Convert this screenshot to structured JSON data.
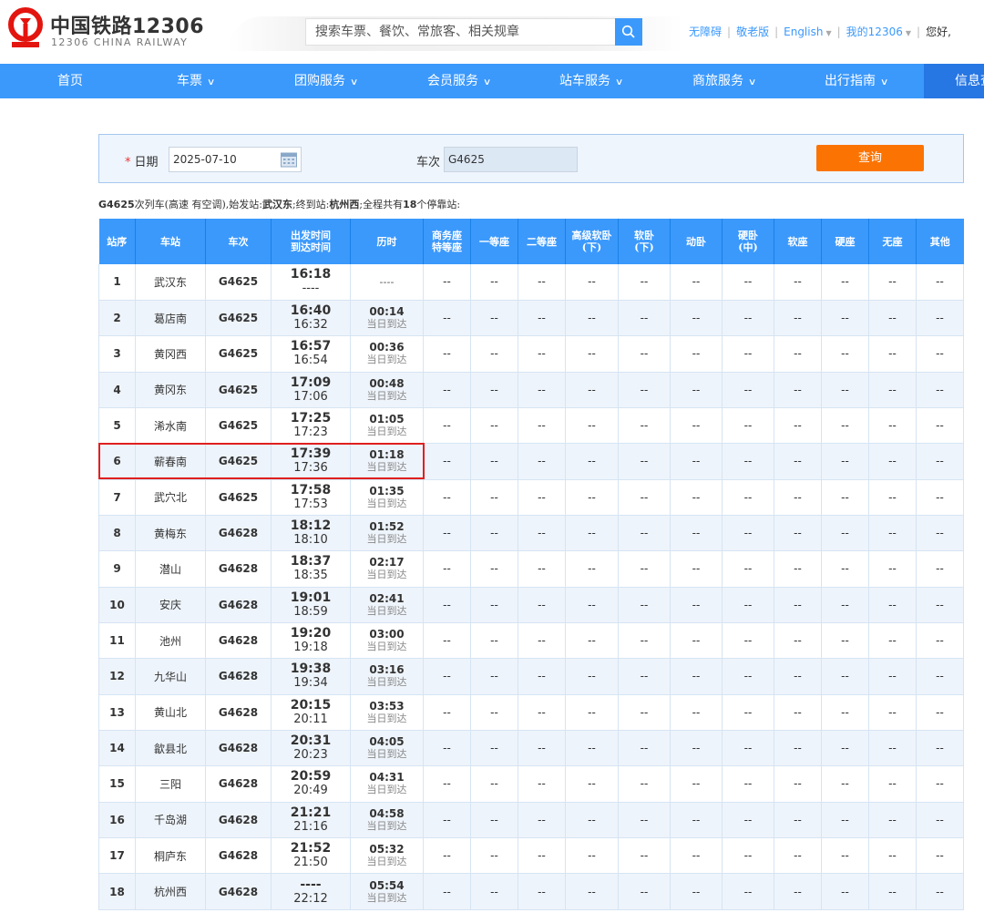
{
  "header": {
    "logo_cn": "中国铁路12306",
    "logo_en": "12306 CHINA RAILWAY",
    "search_placeholder": "搜索车票、餐饮、常旅客、相关规章",
    "links": [
      {
        "label": "无障碍",
        "caret": false
      },
      {
        "label": "敬老版",
        "caret": false
      },
      {
        "label": "English",
        "caret": true
      },
      {
        "label": "我的12306",
        "caret": true
      },
      {
        "label": "您好,",
        "caret": false
      }
    ],
    "brand_color": "#3b99fc"
  },
  "nav": {
    "items": [
      {
        "label": "首页",
        "chevron": false
      },
      {
        "label": "车票",
        "chevron": true
      },
      {
        "label": "团购服务",
        "chevron": true
      },
      {
        "label": "会员服务",
        "chevron": true
      },
      {
        "label": "站车服务",
        "chevron": true
      },
      {
        "label": "商旅服务",
        "chevron": true
      },
      {
        "label": "出行指南",
        "chevron": true
      },
      {
        "label": "信息查",
        "chevron": false
      }
    ]
  },
  "query": {
    "date_label": "日期",
    "required_mark": "*",
    "date_value": "2025-07-10",
    "train_label": "车次",
    "train_value": "G4625",
    "submit_label": "查询"
  },
  "summary": {
    "train": "G4625",
    "text1": "次列车(高速 有空调),始发站:",
    "origin": "武汉东",
    "text2": ";终到站:",
    "destination": "杭州西",
    "text3": ";全程共有",
    "stops": "18",
    "text4": "个停靠站:"
  },
  "table": {
    "headers": [
      [
        "站序"
      ],
      [
        "车站"
      ],
      [
        "车次"
      ],
      [
        "出发时间",
        "到达时间"
      ],
      [
        "历时"
      ],
      [
        "商务座",
        "特等座"
      ],
      [
        "一等座"
      ],
      [
        "二等座"
      ],
      [
        "高级软卧",
        "(下)"
      ],
      [
        "软卧",
        "(下)"
      ],
      [
        "动卧"
      ],
      [
        "硬卧",
        "(中)"
      ],
      [
        "软座"
      ],
      [
        "硬座"
      ],
      [
        "无座"
      ],
      [
        "其他"
      ]
    ],
    "seat_placeholder": "--",
    "highlighted_row": 6,
    "rows": [
      {
        "seq": "1",
        "station": "武汉东",
        "train": "G4625",
        "depart": "16:18",
        "arrive": "----",
        "duration": "----",
        "day": ""
      },
      {
        "seq": "2",
        "station": "葛店南",
        "train": "G4625",
        "depart": "16:40",
        "arrive": "16:32",
        "duration": "00:14",
        "day": "当日到达"
      },
      {
        "seq": "3",
        "station": "黄冈西",
        "train": "G4625",
        "depart": "16:57",
        "arrive": "16:54",
        "duration": "00:36",
        "day": "当日到达"
      },
      {
        "seq": "4",
        "station": "黄冈东",
        "train": "G4625",
        "depart": "17:09",
        "arrive": "17:06",
        "duration": "00:48",
        "day": "当日到达"
      },
      {
        "seq": "5",
        "station": "浠水南",
        "train": "G4625",
        "depart": "17:25",
        "arrive": "17:23",
        "duration": "01:05",
        "day": "当日到达"
      },
      {
        "seq": "6",
        "station": "蕲春南",
        "train": "G4625",
        "depart": "17:39",
        "arrive": "17:36",
        "duration": "01:18",
        "day": "当日到达"
      },
      {
        "seq": "7",
        "station": "武穴北",
        "train": "G4625",
        "depart": "17:58",
        "arrive": "17:53",
        "duration": "01:35",
        "day": "当日到达"
      },
      {
        "seq": "8",
        "station": "黄梅东",
        "train": "G4628",
        "depart": "18:12",
        "arrive": "18:10",
        "duration": "01:52",
        "day": "当日到达"
      },
      {
        "seq": "9",
        "station": "潜山",
        "train": "G4628",
        "depart": "18:37",
        "arrive": "18:35",
        "duration": "02:17",
        "day": "当日到达"
      },
      {
        "seq": "10",
        "station": "安庆",
        "train": "G4628",
        "depart": "19:01",
        "arrive": "18:59",
        "duration": "02:41",
        "day": "当日到达"
      },
      {
        "seq": "11",
        "station": "池州",
        "train": "G4628",
        "depart": "19:20",
        "arrive": "19:18",
        "duration": "03:00",
        "day": "当日到达"
      },
      {
        "seq": "12",
        "station": "九华山",
        "train": "G4628",
        "depart": "19:38",
        "arrive": "19:34",
        "duration": "03:16",
        "day": "当日到达"
      },
      {
        "seq": "13",
        "station": "黄山北",
        "train": "G4628",
        "depart": "20:15",
        "arrive": "20:11",
        "duration": "03:53",
        "day": "当日到达"
      },
      {
        "seq": "14",
        "station": "歙县北",
        "train": "G4628",
        "depart": "20:31",
        "arrive": "20:23",
        "duration": "04:05",
        "day": "当日到达"
      },
      {
        "seq": "15",
        "station": "三阳",
        "train": "G4628",
        "depart": "20:59",
        "arrive": "20:49",
        "duration": "04:31",
        "day": "当日到达"
      },
      {
        "seq": "16",
        "station": "千岛湖",
        "train": "G4628",
        "depart": "21:21",
        "arrive": "21:16",
        "duration": "04:58",
        "day": "当日到达"
      },
      {
        "seq": "17",
        "station": "桐庐东",
        "train": "G4628",
        "depart": "21:52",
        "arrive": "21:50",
        "duration": "05:32",
        "day": "当日到达"
      },
      {
        "seq": "18",
        "station": "杭州西",
        "train": "G4628",
        "depart": "----",
        "arrive": "22:12",
        "duration": "05:54",
        "day": "当日到达"
      }
    ]
  }
}
